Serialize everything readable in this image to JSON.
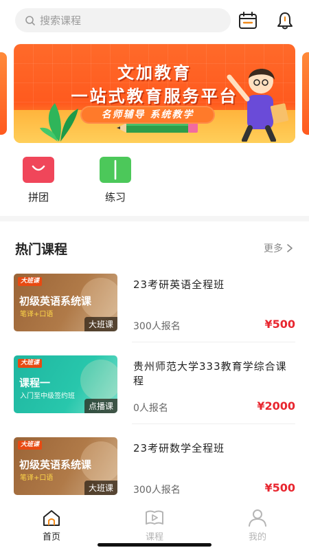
{
  "search": {
    "placeholder": "搜索课程"
  },
  "banner": {
    "title": "文加教育",
    "subtitle": "一站式教育服务平台",
    "tagline": "名师辅导  系统教学"
  },
  "quick_actions": [
    {
      "label": "拼团",
      "icon": "shopping-bag-icon",
      "color": "#f0465a"
    },
    {
      "label": "练习",
      "icon": "open-book-icon",
      "color": "#4cc85a"
    }
  ],
  "section": {
    "title": "热门课程",
    "more_label": "更多"
  },
  "courses": [
    {
      "title": "23考研英语全程班",
      "enrolled": "300人报名",
      "price": "¥500",
      "thumb": {
        "tag": "大班课",
        "headline": "初级英语系统课",
        "sub": "笔译+口语",
        "corner": "大班课",
        "style": "brown"
      }
    },
    {
      "title": "贵州师范大学333教育学综合课程",
      "enrolled": "0人报名",
      "price": "¥2000",
      "thumb": {
        "tag": "大班课",
        "headline": "课程一",
        "sub": "入门至中级签约班",
        "corner": "点播课",
        "style": "teal"
      }
    },
    {
      "title": "23考研数学全程班",
      "enrolled": "300人报名",
      "price": "¥500",
      "thumb": {
        "tag": "大班课",
        "headline": "初级英语系统课",
        "sub": "笔译+口语",
        "corner": "大班课",
        "style": "brown"
      }
    }
  ],
  "bottom_nav": [
    {
      "label": "首页",
      "icon": "home-icon",
      "active": true
    },
    {
      "label": "课程",
      "icon": "play-book-icon",
      "active": false
    },
    {
      "label": "我的",
      "icon": "user-icon",
      "active": false
    }
  ],
  "colors": {
    "accent_orange": "#ff5a1e",
    "price_red": "#e8262f",
    "nav_inactive": "#b5b5b5",
    "nav_active": "#222222"
  }
}
